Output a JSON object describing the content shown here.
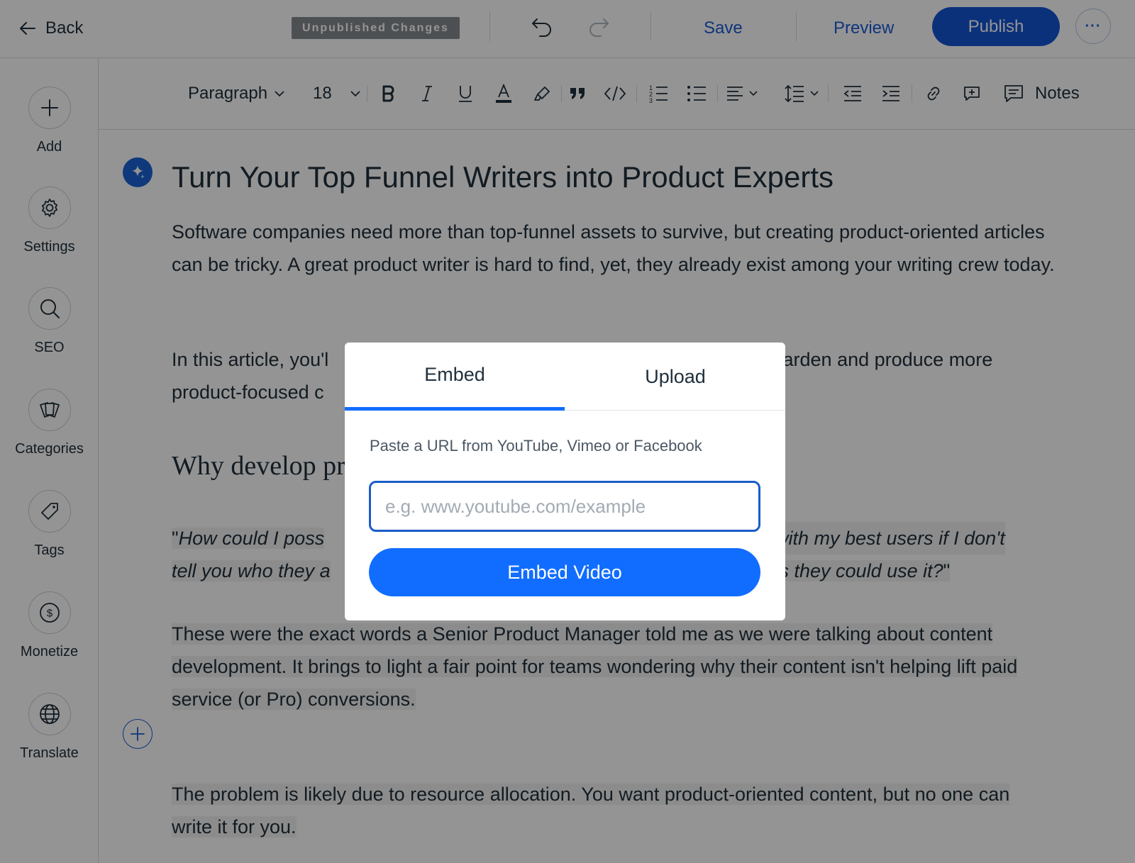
{
  "topbar": {
    "back_label": "Back",
    "status_badge": "Unpublished Changes",
    "save_label": "Save",
    "preview_label": "Preview",
    "publish_label": "Publish",
    "more_label": "···",
    "icons": [
      "arrow-left-icon",
      "undo-icon",
      "redo-icon",
      "more-icon"
    ]
  },
  "sidebar": {
    "items": [
      {
        "label": "Add",
        "icon": "plus-icon"
      },
      {
        "label": "Settings",
        "icon": "gear-icon"
      },
      {
        "label": "SEO",
        "icon": "search-icon"
      },
      {
        "label": "Categories",
        "icon": "cards-icon"
      },
      {
        "label": "Tags",
        "icon": "tag-icon"
      },
      {
        "label": "Monetize",
        "icon": "dollar-icon"
      },
      {
        "label": "Translate",
        "icon": "globe-icon"
      }
    ]
  },
  "toolbar": {
    "paragraph_style": "Paragraph",
    "font_size": "18",
    "notes_label": "Notes",
    "icons": [
      "bold-icon",
      "italic-icon",
      "underline-icon",
      "text-color-icon",
      "highlight-icon",
      "quote-icon",
      "code-icon",
      "numbered-list-icon",
      "bulleted-list-icon",
      "align-icon",
      "line-spacing-icon",
      "outdent-icon",
      "indent-icon",
      "link-icon",
      "comment-icon",
      "notes-icon"
    ]
  },
  "article": {
    "title": "Turn Your Top Funnel Writers into Product Experts",
    "p1": "Software companies need more than top-funnel assets to survive, but creating product-oriented articles can be tricky. A great product writer is hard to find, yet, they already exist among your writing crew today.",
    "p2_line1_start": "In this article, you'l",
    "p2_line1_end": "r garden and produce more",
    "p2_line2_start": "product-focused c",
    "heading_partial": "Why develop pr",
    "quote_open": "\"",
    "quote_line1_start": "How could I poss",
    "quote_line1_end": "with my best users if I don't",
    "quote_line2_start": "tell you who they a",
    "quote_line2_end": "ys they could use it?",
    "quote_close": "\"",
    "p3": "These were the exact words a Senior Product Manager told me as we were talking about content development. It brings to light a fair point for teams wondering why their content isn't helping lift paid service (or Pro) conversions. ",
    "p4": "The problem is likely due to resource allocation. You want product-oriented content, but no one can write it for you. "
  },
  "modal": {
    "tabs": [
      {
        "label": "Embed",
        "active": true
      },
      {
        "label": "Upload",
        "active": false
      }
    ],
    "hint": "Paste a URL from YouTube, Vimeo or Facebook",
    "url_value": "",
    "url_placeholder": "e.g. www.youtube.com/example",
    "embed_button": "Embed Video"
  },
  "colors": {
    "accent": "#116dff",
    "publish_bg": "#1555d4",
    "link": "#1b5bd6",
    "badge_bg": "#868a90",
    "text": "#20303c"
  }
}
